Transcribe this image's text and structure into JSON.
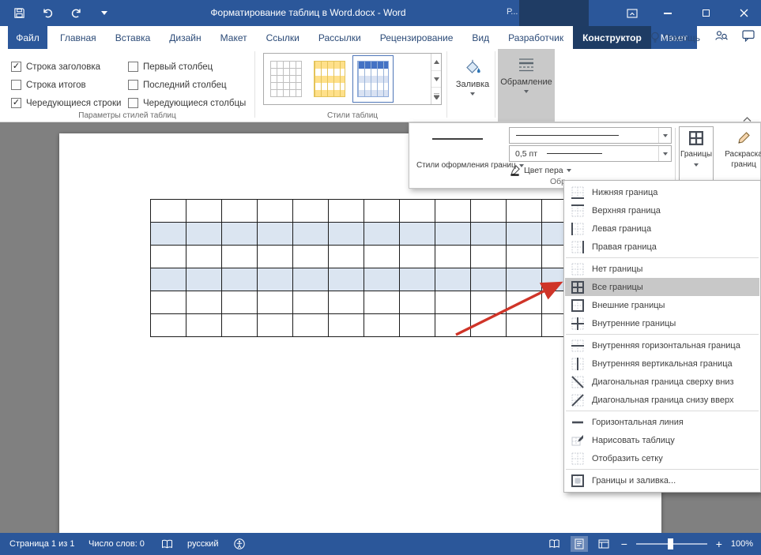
{
  "title_bar": {
    "title": "Форматирование таблиц в Word.docx - Word",
    "contextual_group": "Р..."
  },
  "tabs": {
    "file": "Файл",
    "items": [
      {
        "label": "Главная"
      },
      {
        "label": "Вставка"
      },
      {
        "label": "Дизайн"
      },
      {
        "label": "Макет"
      },
      {
        "label": "Ссылки"
      },
      {
        "label": "Рассылки"
      },
      {
        "label": "Рецензирование"
      },
      {
        "label": "Вид"
      },
      {
        "label": "Разработчик"
      },
      {
        "label": "Конструктор",
        "contextual": true,
        "active": true
      },
      {
        "label": "Макет",
        "contextual": true
      }
    ],
    "help": "Помощь"
  },
  "ribbon": {
    "style_options": {
      "group_label": "Параметры стилей таблиц",
      "items": [
        {
          "label": "Строка заголовка",
          "checked": true
        },
        {
          "label": "Первый столбец",
          "checked": false
        },
        {
          "label": "Строка итогов",
          "checked": false
        },
        {
          "label": "Последний столбец",
          "checked": false
        },
        {
          "label": "Чередующиеся строки",
          "checked": true
        },
        {
          "label": "Чередующиеся столбцы",
          "checked": false
        }
      ]
    },
    "table_styles": {
      "group_label": "Стили таблиц",
      "thumbnails": [
        {
          "name": "plain",
          "selected": false
        },
        {
          "name": "yellow",
          "selected": false
        },
        {
          "name": "blue",
          "selected": true
        }
      ]
    },
    "shading": {
      "label": "Заливка"
    },
    "borders_gallery": {
      "label": "Обрамление"
    }
  },
  "border_flyout": {
    "border_styles_label": "Стили оформления границ",
    "pen_weight": "0,5 пт",
    "pen_color_label": "Цвет пера",
    "borders_button_label": "Границы",
    "border_painter_label": "Раскраска границ",
    "group_label_visible": "Обр"
  },
  "borders_menu": {
    "items": [
      {
        "label": "Нижняя граница",
        "icon": "border-bottom"
      },
      {
        "label": "Верхняя граница",
        "icon": "border-top"
      },
      {
        "label": "Левая граница",
        "icon": "border-left"
      },
      {
        "label": "Правая граница",
        "icon": "border-right"
      },
      {
        "separator": true
      },
      {
        "label": "Нет границы",
        "icon": "border-none"
      },
      {
        "label": "Все границы",
        "icon": "border-all",
        "highlighted": true
      },
      {
        "label": "Внешние границы",
        "icon": "border-outside"
      },
      {
        "label": "Внутренние границы",
        "icon": "border-inside"
      },
      {
        "separator": true
      },
      {
        "label": "Внутренняя горизонтальная граница",
        "icon": "border-inside-h"
      },
      {
        "label": "Внутренняя вертикальная граница",
        "icon": "border-inside-v"
      },
      {
        "label": "Диагональная граница сверху вниз",
        "icon": "border-diag-down"
      },
      {
        "label": "Диагональная граница снизу вверх",
        "icon": "border-diag-up"
      },
      {
        "separator": true
      },
      {
        "label": "Горизонтальная линия",
        "icon": "horizontal-line"
      },
      {
        "label": "Нарисовать таблицу",
        "icon": "draw-table"
      },
      {
        "label": "Отобразить сетку",
        "icon": "view-gridlines"
      },
      {
        "separator": true
      },
      {
        "label": "Границы и заливка...",
        "icon": "borders-shading"
      }
    ]
  },
  "document": {
    "table": {
      "rows": 6,
      "columns": 12,
      "banded_row_indices": [
        1,
        3
      ],
      "band_color": "#dbe5f1"
    }
  },
  "status_bar": {
    "page": "Страница 1 из 1",
    "words": "Число слов: 0",
    "language": "русский",
    "zoom_out": "−",
    "zoom_in": "+",
    "zoom_level": "100%"
  },
  "colors": {
    "titlebar": "#2b579a",
    "contextual_tab_active": "#1e3c64",
    "row_band": "#dbe5f1",
    "annotation_arrow": "#cf3428",
    "menu_highlight": "#c8c8c8"
  }
}
